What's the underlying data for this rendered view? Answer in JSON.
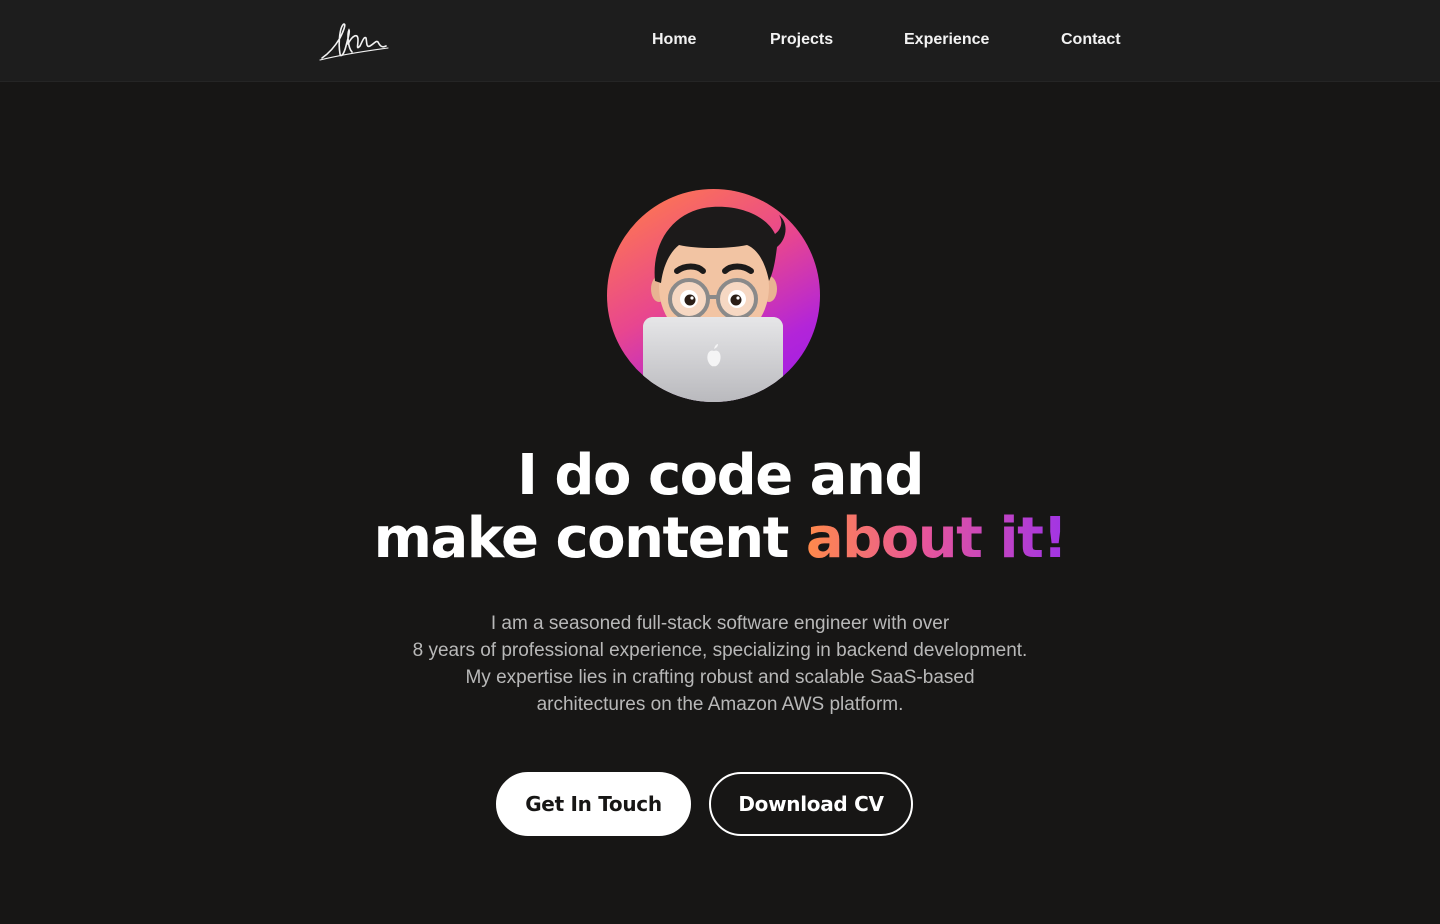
{
  "nav": {
    "logo_name": "signature-logo",
    "links": [
      {
        "label": "Home"
      },
      {
        "label": "Projects"
      },
      {
        "label": "Experience"
      },
      {
        "label": "Contact"
      }
    ]
  },
  "hero": {
    "avatar_icon": "memoji-laptop-avatar",
    "headline_line1": "I do code and",
    "headline_line2_plain": "make content ",
    "headline_line2_accent": "about it!",
    "bio_lines": [
      "I am a seasoned full-stack software engineer with over",
      "8 years of professional experience, specializing in backend development.",
      "My expertise lies in crafting robust and scalable SaaS-based",
      "architectures on the Amazon AWS platform."
    ],
    "primary_button": "Get In Touch",
    "secondary_button": "Download CV"
  },
  "colors": {
    "background": "#171615",
    "navbar": "#1d1d1d",
    "accent_gradient_start": "#ff8a4a",
    "accent_gradient_mid": "#e8569a",
    "accent_gradient_end": "#a034e6"
  }
}
